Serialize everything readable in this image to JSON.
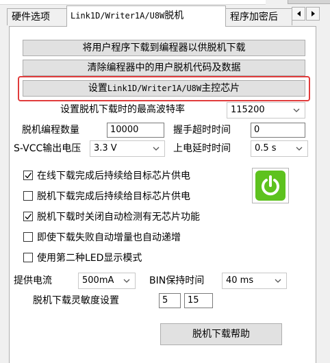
{
  "tabs": {
    "hardware": "硬件选项",
    "link_prefix": "Link1D/Writer1A/U8W",
    "link_suffix": "脱机",
    "encrypt": "程序加密后"
  },
  "buttons": {
    "download_user_program": "将用户程序下载到编程器以供脱机下载",
    "clear_offline_code": "清除编程器中的用户脱机代码及数据",
    "set_chip_prefix": "设置",
    "set_chip_model": "Link1D/Writer1A/U8W",
    "set_chip_suffix": "主控芯片",
    "help": "脱机下载帮助"
  },
  "settings": {
    "max_baud_label": "设置脱机下载时的最高波特率",
    "max_baud_value": "115200",
    "program_count_label": "脱机编程数量",
    "program_count_value": "10000",
    "handshake_timeout_label": "握手超时时间",
    "handshake_timeout_value": "0",
    "svcc_label": "S-VCC输出电压",
    "svcc_value": "3.3 V",
    "power_delay_label": "上电延时时间",
    "power_delay_value": "0.5 s",
    "supply_current_label": "提供电流",
    "supply_current_value": "500mA",
    "bin_hold_label": "BIN保持时间",
    "bin_hold_value": "40 ms",
    "sensitivity_label": "脱机下载灵敏度设置",
    "sensitivity_value1": "5",
    "sensitivity_value2": "15"
  },
  "checkboxes": [
    {
      "label": "在线下载完成后持续给目标芯片供电",
      "checked": true
    },
    {
      "label": "脱机下载完成后持续给目标芯片供电",
      "checked": false
    },
    {
      "label": "脱机下载时关闭自动检测有无芯片功能",
      "checked": true
    },
    {
      "label": "即使下载失败自动增量也自动递增",
      "checked": false
    },
    {
      "label": "使用第二种LED显示模式",
      "checked": false
    }
  ],
  "colors": {
    "highlight": "#e03b3b",
    "power_green": "#5dc21e"
  },
  "icons": {
    "power": "power-icon",
    "scroll_left": "scroll-left-icon",
    "scroll_right": "scroll-right-icon"
  }
}
